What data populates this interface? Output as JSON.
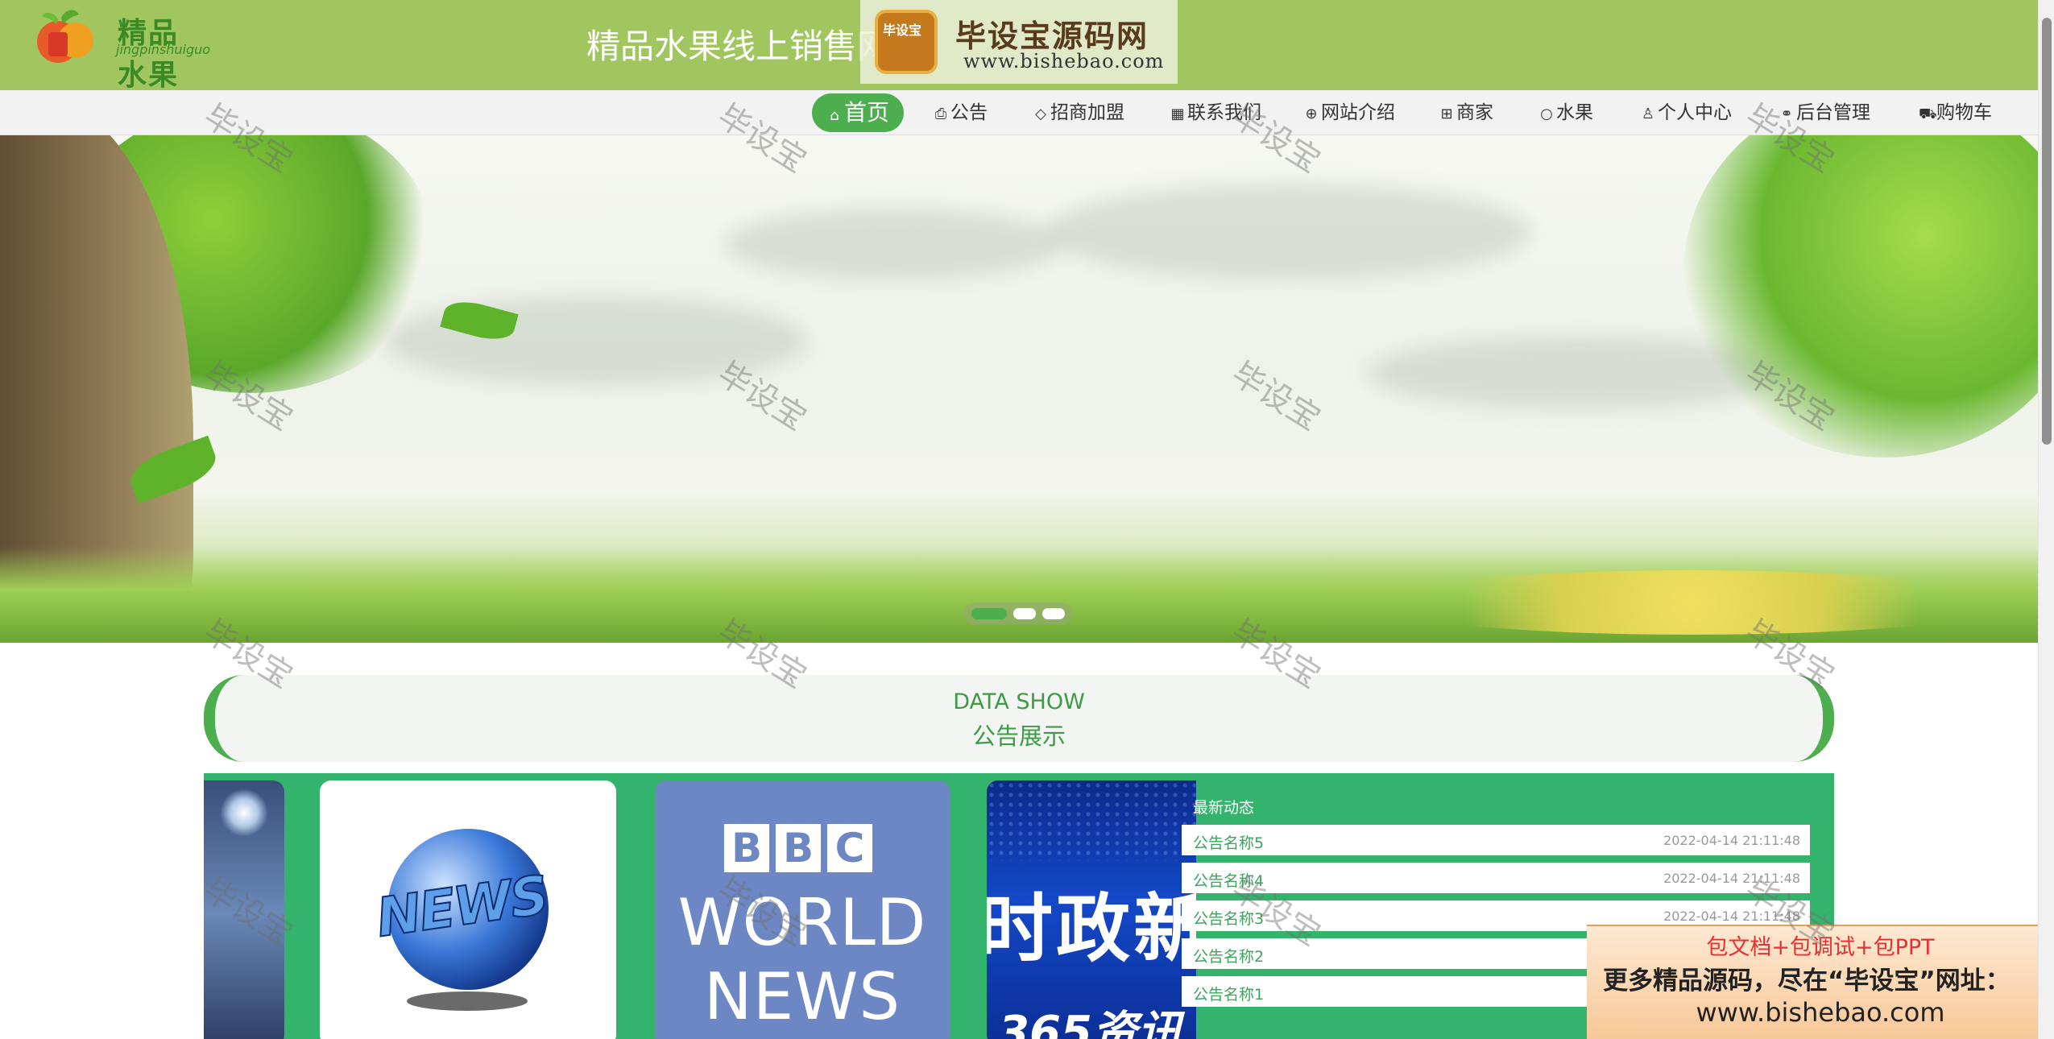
{
  "header": {
    "logo_text": "精品水果",
    "logo_sub": "jingpinshuiguo",
    "title": "精品水果线上销售网"
  },
  "watermark_badge": {
    "icon_text": "毕设宝",
    "title": "毕设宝源码网",
    "url": "www.bishebao.com"
  },
  "nav": {
    "items": [
      {
        "label": "首页",
        "icon": "home-icon",
        "active": true
      },
      {
        "label": "公告",
        "icon": "printer-icon"
      },
      {
        "label": "招商加盟",
        "icon": "tag-icon"
      },
      {
        "label": "联系我们",
        "icon": "grid-icon"
      },
      {
        "label": "网站介绍",
        "icon": "globe-icon"
      },
      {
        "label": "商家",
        "icon": "apps-icon"
      },
      {
        "label": "水果",
        "icon": "circle-icon"
      },
      {
        "label": "个人中心",
        "icon": "user-icon"
      },
      {
        "label": "后台管理",
        "icon": "link-icon"
      },
      {
        "label": "购物车",
        "icon": "cart-icon"
      }
    ]
  },
  "banner": {
    "slides": 3,
    "active_slide": 1
  },
  "section": {
    "title_en": "DATA SHOW",
    "title_cn": "公告展示"
  },
  "cards": {
    "news_text": "NEWS",
    "bbc_letters": [
      "B",
      "B",
      "C"
    ],
    "bbc_world": "WORLD",
    "bbc_news": "NEWS",
    "politics_text": "时政新",
    "politics_sub": "365资讯"
  },
  "news": {
    "heading": "最新动态",
    "items": [
      {
        "title": "公告名称5",
        "date": "2022-04-14 21:11:48"
      },
      {
        "title": "公告名称4",
        "date": "2022-04-14 21:11:48"
      },
      {
        "title": "公告名称3",
        "date": "2022-04-14 21:11:48"
      },
      {
        "title": "公告名称2",
        "date": ""
      },
      {
        "title": "公告名称1",
        "date": ""
      }
    ]
  },
  "ad": {
    "line1": "包文档+包调试+包PPT",
    "line2": "更多精品源码，尽在“毕设宝”网址：",
    "line3": "www.bishebao.com"
  },
  "watermark": "毕设宝",
  "colors": {
    "header_bg": "#a1c660",
    "accent_green": "#4cae4c",
    "content_bg": "#34b36c"
  }
}
